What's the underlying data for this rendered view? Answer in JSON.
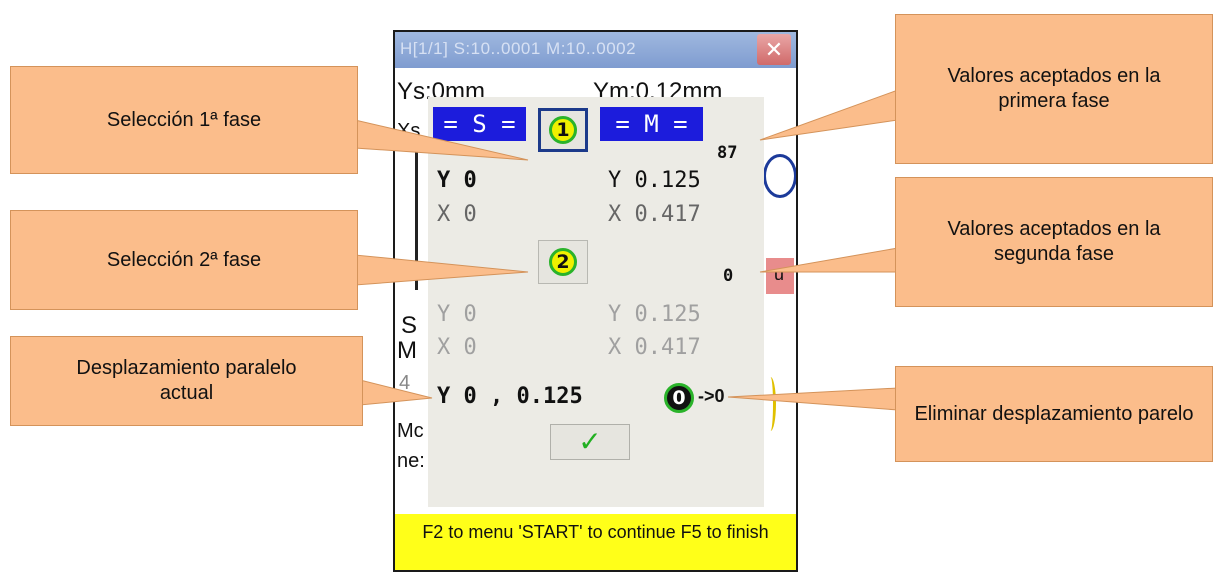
{
  "window": {
    "title": "H[1/1] S:10..0001  M:10..0002",
    "close_glyph": "✕"
  },
  "background": {
    "ys_label": "Ys:0mm",
    "ym_label": "Ym:0.12mm",
    "xs_label": "Xs",
    "s_letter": "S",
    "m_letter": "M",
    "four": "4",
    "mc_text": "Mc",
    "ne_text": "ne:",
    "u_badge": "u",
    "u_badge_color": "#e88c8c"
  },
  "dialog": {
    "s_tag": "= S =",
    "m_tag": "= M =",
    "phase1_num": "1",
    "phase2_num": "2",
    "phase1_count": "87",
    "phase2_count": "0",
    "phase1": {
      "s_y": "Y 0",
      "s_x": "X 0",
      "m_y": "Y 0.125",
      "m_x": "X 0.417"
    },
    "phase2": {
      "s_y": "Y 0",
      "s_x": "X 0",
      "m_y": "Y 0.125",
      "m_x": "X 0.417"
    },
    "current_offset": "Y 0 , 0.125",
    "zero_num": "0",
    "arrow_text": "->0",
    "ok_glyph": "✓",
    "accent_color": "#1c1cdc"
  },
  "footer": {
    "text": "F2 to menu 'START' to continue F5 to finish",
    "color": "#ffff19"
  },
  "callouts": {
    "phase1_select": "Selección 1ª fase",
    "phase2_select": "Selección 2ª fase",
    "current_offset": "Desplazamiento paralelo actual",
    "accepted_phase1": "Valores aceptados en la primera fase",
    "accepted_phase2": "Valores aceptados en la segunda fase",
    "remove_offset": "Eliminar desplazamiento parelo",
    "color": "#fbbd8b"
  }
}
